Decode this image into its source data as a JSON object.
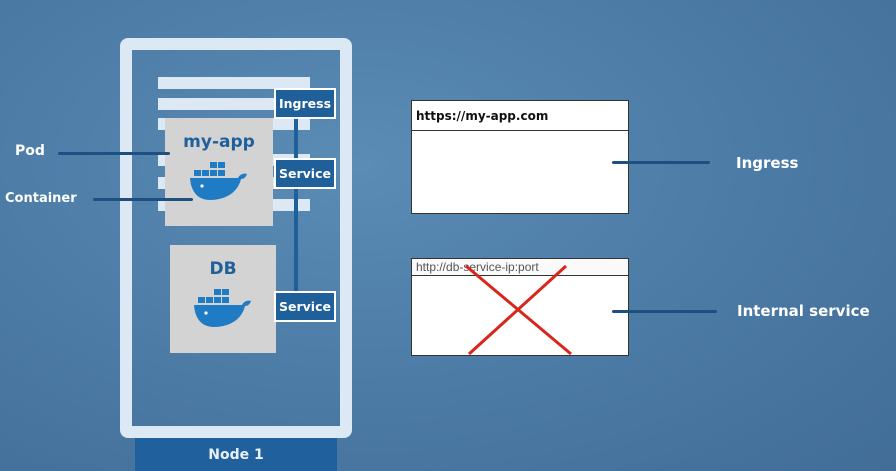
{
  "node": {
    "label": "Node 1"
  },
  "pods": [
    {
      "name": "my-app"
    },
    {
      "name": "DB"
    }
  ],
  "components": {
    "ingress": "Ingress",
    "service_app": "Service",
    "service_db": "Service"
  },
  "callouts": {
    "pod": "Pod",
    "container": "Container",
    "ingress": "Ingress",
    "internal_service": "Internal service"
  },
  "browsers": [
    {
      "url": "https://my-app.com",
      "blocked": false
    },
    {
      "url": "http://db-service-ip:port",
      "blocked": true
    }
  ],
  "colors": {
    "background": "#4b7aa5",
    "primary_blue": "#1f5f9a",
    "frame": "#dce8f4",
    "pod_gray": "#d3d3d3",
    "cross_red": "#d9261c"
  },
  "icons": {
    "container": "docker-whale-icon"
  }
}
